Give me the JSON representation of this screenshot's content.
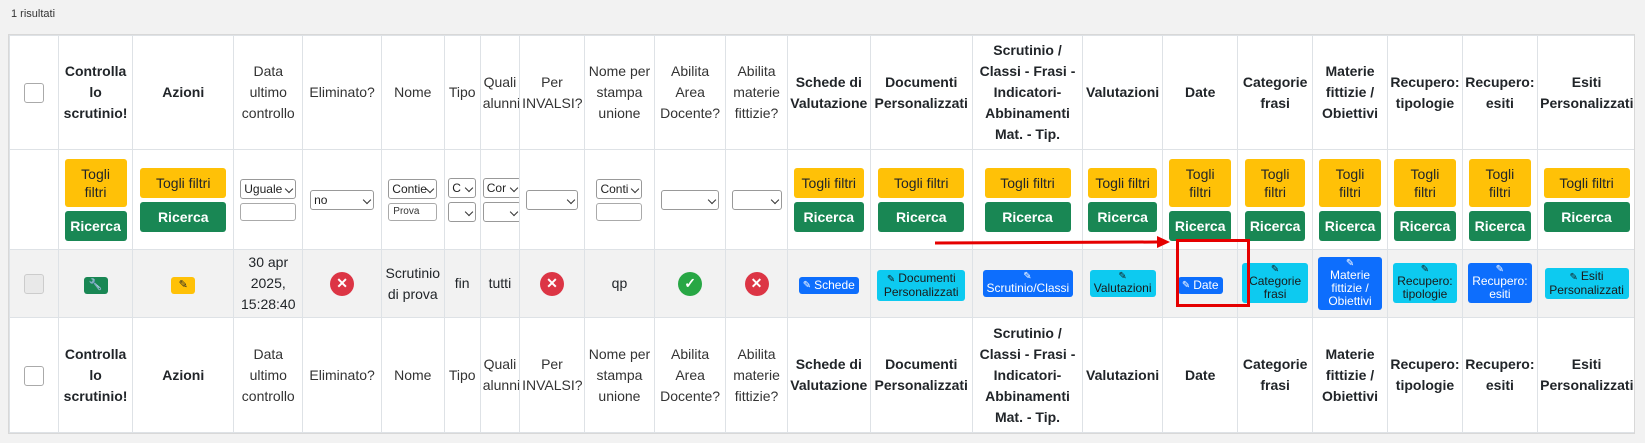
{
  "results_count": "1 risultati",
  "headers": [
    {
      "key": "controlla",
      "label": "Controlla lo scrutinio!",
      "bold": true
    },
    {
      "key": "azioni",
      "label": "Azioni",
      "bold": true
    },
    {
      "key": "data",
      "label": "Data ultimo controllo",
      "bold": false
    },
    {
      "key": "eliminato",
      "label": "Eliminato?",
      "bold": false
    },
    {
      "key": "nome",
      "label": "Nome",
      "bold": false
    },
    {
      "key": "tipo",
      "label": "Tipo",
      "bold": false
    },
    {
      "key": "quali",
      "label": "Quali alunni",
      "bold": false
    },
    {
      "key": "invalsi",
      "label": "Per INVALSI?",
      "bold": false
    },
    {
      "key": "nome_stampa",
      "label": "Nome per stampa unione",
      "bold": false
    },
    {
      "key": "abilita_area",
      "label": "Abilita Area Docente?",
      "bold": false
    },
    {
      "key": "abilita_materie",
      "label": "Abilita materie fittizie?",
      "bold": false
    },
    {
      "key": "schede",
      "label": "Schede di Valutazione",
      "bold": true
    },
    {
      "key": "documenti",
      "label": "Documenti Personalizzati",
      "bold": true
    },
    {
      "key": "scrutinio",
      "label": "Scrutinio / Classi - Frasi - Indicatori- Abbinamenti Mat. - Tip.",
      "bold": true
    },
    {
      "key": "valutazioni",
      "label": "Valutazioni",
      "bold": true
    },
    {
      "key": "date",
      "label": "Date",
      "bold": true
    },
    {
      "key": "categorie",
      "label": "Categorie frasi",
      "bold": true
    },
    {
      "key": "materie",
      "label": "Materie fittizie / Obiettivi",
      "bold": true
    },
    {
      "key": "rec_tip",
      "label": "Recupero: tipologie",
      "bold": true
    },
    {
      "key": "rec_esiti",
      "label": "Recupero: esiti",
      "bold": true
    },
    {
      "key": "esiti",
      "label": "Esiti Personalizzati",
      "bold": true
    }
  ],
  "filters": {
    "clear_label": "Togli filtri",
    "search_label": "Ricerca",
    "data_operator": "Uguale",
    "eliminato_value": "no",
    "nome_operator": "Contie",
    "nome_value": "Prova",
    "tipo_operator": "C",
    "quali_operator": "Cor",
    "nome_stampa_operator": "Conti"
  },
  "row": {
    "data_ultimo_controllo": "30 apr 2025, 15:28:40",
    "eliminato": "no",
    "nome": "Scrutinio di prova",
    "tipo": "fin",
    "quali_alunni": "tutti",
    "per_invalsi": "no",
    "nome_stampa": "qp",
    "abilita_area": "yes",
    "abilita_materie": "no",
    "schede_btn": "Schede",
    "documenti_btn": "Documenti Personalizzati",
    "scrutinio_btn": "Scrutinio/Classi",
    "valutazioni_btn": "Valutazioni",
    "date_btn": "Date",
    "categorie_btn": "Categorie frasi",
    "materie_btn": "Materie fittizie / Obiettivi",
    "rec_tip_btn": "Recupero: tipologie",
    "rec_esiti_btn": "Recupero: esiti",
    "esiti_btn": "Esiti Personalizzati"
  },
  "colors": {
    "warning": "#ffc107",
    "success": "#198754",
    "primary": "#0d6efd",
    "info": "#0dcaf0",
    "danger": "#dc3545",
    "ok": "#28a745",
    "annotation": "#e50000"
  },
  "icons": {
    "wrench": "wrench-icon",
    "edit": "edit-icon",
    "x": "x-circle-icon",
    "check": "check-circle-icon"
  }
}
